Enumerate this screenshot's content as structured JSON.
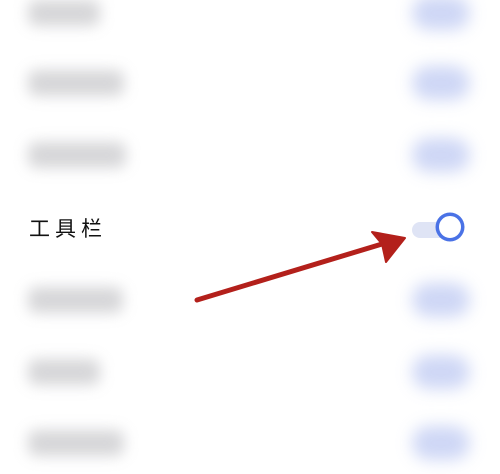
{
  "settings": {
    "highlighted_item": {
      "label": "工具栏",
      "toggle_on": true
    }
  },
  "colors": {
    "accent": "#4a72e6",
    "track": "#dfe4f5",
    "annotation_arrow": "#b3201b",
    "text": "#111111"
  },
  "icons": {
    "annotation": "arrow-icon"
  }
}
